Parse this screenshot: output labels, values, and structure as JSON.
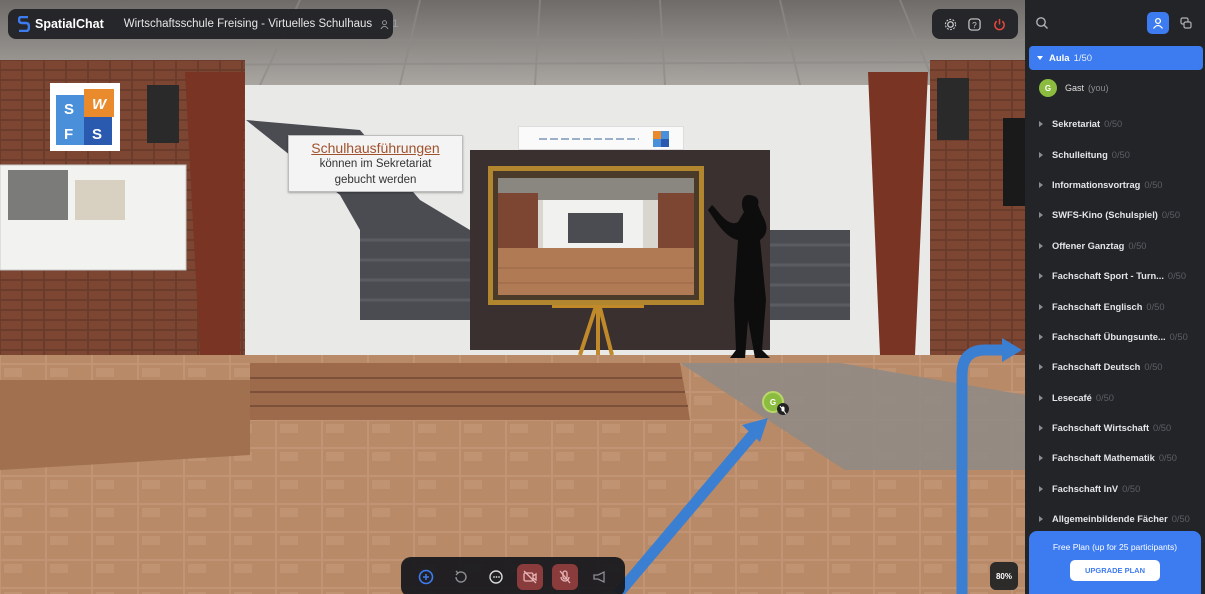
{
  "app": {
    "brand": "SpatialChat",
    "room_title": "Wirtschaftsschule Freising - Virtuelles Schulhaus",
    "participants": "1"
  },
  "scene": {
    "sign_line1": "Schulhausführungen",
    "sign_line2": "können im Sekretariat",
    "sign_line3": "gebucht werden",
    "avatar_initial": "G",
    "zoom": "80%"
  },
  "school_logo_letters": [
    "S",
    "W",
    "F",
    "S"
  ],
  "toolbar": {
    "buttons": [
      "add-icon",
      "share-icon",
      "chat-icon",
      "camera-off-icon",
      "mic-off-icon",
      "megaphone-icon"
    ]
  },
  "topright": {
    "icons": [
      "settings-icon",
      "help-icon",
      "power-icon"
    ]
  },
  "sidebar": {
    "active_room": {
      "name": "Aula",
      "count": "1/50"
    },
    "user": {
      "initial": "G",
      "name": "Gast",
      "tag": "(you)"
    },
    "rooms": [
      {
        "name": "Sekretariat",
        "count": "0/50"
      },
      {
        "name": "Schulleitung",
        "count": "0/50"
      },
      {
        "name": "Informationsvortrag",
        "count": "0/50"
      },
      {
        "name": "SWFS-Kino (Schulspiel)",
        "count": "0/50"
      },
      {
        "name": "Offener Ganztag",
        "count": "0/50"
      },
      {
        "name": "Fachschaft Sport - Turn...",
        "count": "0/50"
      },
      {
        "name": "Fachschaft Englisch",
        "count": "0/50"
      },
      {
        "name": "Fachschaft Übungsunte...",
        "count": "0/50"
      },
      {
        "name": "Fachschaft Deutsch",
        "count": "0/50"
      },
      {
        "name": "Lesecafé",
        "count": "0/50"
      },
      {
        "name": "Fachschaft Wirtschaft",
        "count": "0/50"
      },
      {
        "name": "Fachschaft Mathematik",
        "count": "0/50"
      },
      {
        "name": "Fachschaft InV",
        "count": "0/50"
      },
      {
        "name": "Allgemeinbildende Fächer",
        "count": "0/50"
      }
    ],
    "plan_text": "Free Plan (up for 25 participants)",
    "upgrade_label": "UPGRADE PLAN"
  },
  "colors": {
    "accent": "#3d7cf0",
    "sidebar_bg": "#232428",
    "avatar": "#8cbc3f",
    "danger": "#8a3b3b"
  }
}
